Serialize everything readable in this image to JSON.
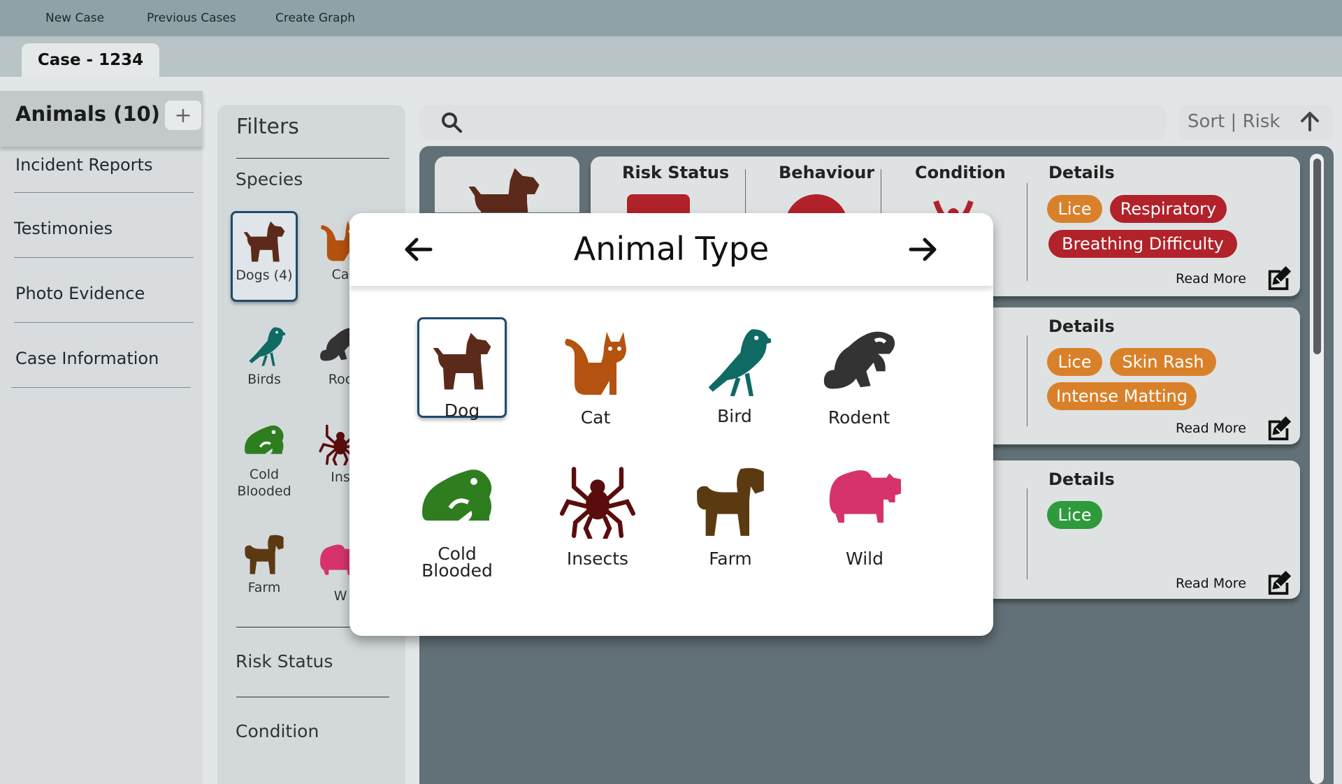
{
  "menu": {
    "items": [
      "New Case",
      "Previous Cases",
      "Create Graph"
    ]
  },
  "tab": {
    "label": "Case - 1234"
  },
  "sidebar": {
    "title": "Animals (10)",
    "add_label": "+",
    "items": [
      "Incident Reports",
      "Testimonies",
      "Photo Evidence",
      "Case Information"
    ]
  },
  "filters": {
    "title": "Filters",
    "sections": {
      "species": "Species",
      "risk": "Risk  Status",
      "condition": "Condition"
    },
    "species": [
      {
        "label": "Dogs",
        "count": "(4)",
        "icon": "dog-icon",
        "color": "#5b2a1a",
        "selected": true
      },
      {
        "label": "Ca",
        "icon": "cat-icon",
        "color": "#b4520f"
      },
      {
        "label": "Birds",
        "icon": "bird-icon",
        "color": "#0f6a63"
      },
      {
        "label": "Roc",
        "icon": "rodent-icon",
        "color": "#333333"
      },
      {
        "label": "Cold Blooded",
        "icon": "frog-icon",
        "color": "#2e7d1e"
      },
      {
        "label": "Ins",
        "icon": "spider-icon",
        "color": "#5a0d0d"
      },
      {
        "label": "Farm",
        "icon": "horse-icon",
        "color": "#5b3a12"
      },
      {
        "label": "W",
        "icon": "hippo-icon",
        "color": "#d6336c"
      }
    ]
  },
  "search": {
    "placeholder": "",
    "icon": "search-icon"
  },
  "sort": {
    "label": "Sort | Risk",
    "icon": "arrow-up-icon"
  },
  "cards": [
    {
      "columns": [
        "Risk Status",
        "Behaviour",
        "Condition"
      ],
      "details_label": "Details",
      "tags": [
        {
          "text": "Lice",
          "color": "orange"
        },
        {
          "text": "Respiratory",
          "color": "red"
        },
        {
          "text": "Breathing Difficulty",
          "color": "red"
        }
      ],
      "read_more": "Read More"
    },
    {
      "details_label": "Details",
      "tags": [
        {
          "text": "Lice",
          "color": "orange"
        },
        {
          "text": "Skin Rash",
          "color": "orange"
        },
        {
          "text": "Intense Matting",
          "color": "orange"
        }
      ],
      "read_more": "Read More"
    },
    {
      "details_label": "Details",
      "tags": [
        {
          "text": "Lice",
          "color": "green"
        }
      ],
      "read_more": "Read More"
    }
  ],
  "modal": {
    "title": "Animal Type",
    "options": [
      {
        "label": "Dog",
        "icon": "dog-icon",
        "color": "#5b2a1a",
        "selected": true
      },
      {
        "label": "Cat",
        "icon": "cat-icon",
        "color": "#b4520f"
      },
      {
        "label": "Bird",
        "icon": "bird-icon",
        "color": "#0f6a63"
      },
      {
        "label": "Rodent",
        "icon": "rodent-icon",
        "color": "#333333"
      },
      {
        "label": "Cold Blooded",
        "icon": "frog-icon",
        "color": "#2e7d1e"
      },
      {
        "label": "Insects",
        "icon": "spider-icon",
        "color": "#5a0d0d"
      },
      {
        "label": "Farm",
        "icon": "horse-icon",
        "color": "#5b3a12"
      },
      {
        "label": "Wild",
        "icon": "hippo-icon",
        "color": "#d6336c"
      }
    ]
  },
  "colors": {
    "topbar": "#8fa2a5",
    "main_bg": "#627077",
    "selection_border": "#1f4a6e"
  }
}
